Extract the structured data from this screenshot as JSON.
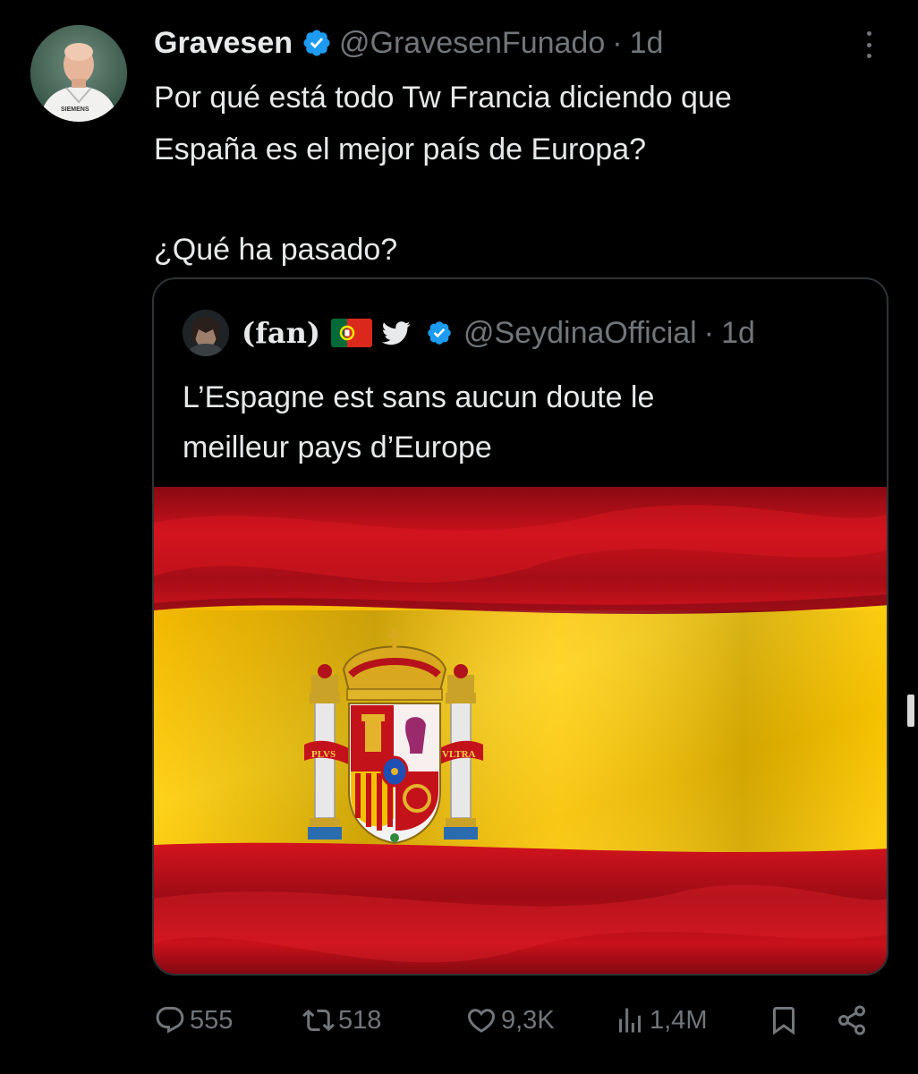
{
  "tweet": {
    "author": {
      "display_name": "Gravesen",
      "handle": "@GravesenFunado",
      "separator": "·",
      "time": "1d",
      "verified": true,
      "avatar_text": "SIEMENS"
    },
    "body": {
      "line1": "Por qué está todo Tw Francia diciendo que",
      "line2": "España es el mejor país de Europa?",
      "line3": "¿Qué ha pasado?"
    },
    "quoted": {
      "display_name": "(fan)",
      "emojis": [
        "portugal-flag-emoji",
        "twitter-bird-emoji"
      ],
      "verified": true,
      "handle": "@SeydinaOfficial",
      "separator": "·",
      "time": "1d",
      "text_line1": "L’Espagne est sans aucun doute le",
      "text_line2": "meilleur pays d’Europe",
      "media": {
        "subject": "spain-flag",
        "motto_left": "PLVS",
        "motto_right": "VLTRA",
        "colors": {
          "red": "#c60b1e",
          "yellow": "#ffc400"
        }
      }
    },
    "actions": {
      "replies": "555",
      "retweets": "518",
      "likes": "9,3K",
      "views": "1,4M"
    }
  },
  "colors": {
    "background": "#000000",
    "text": "#e7e9ea",
    "muted": "#71767b",
    "border": "#2f3336",
    "verified_blue": "#1d9bf0"
  }
}
